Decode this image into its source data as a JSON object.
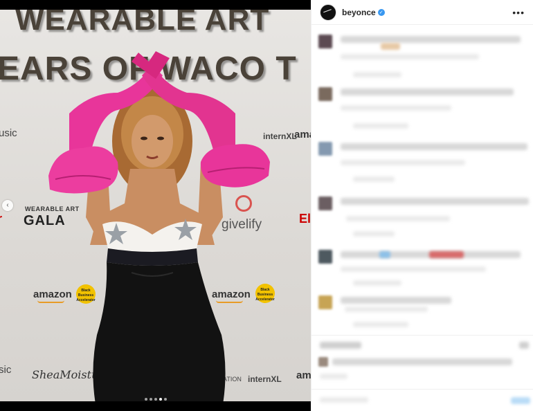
{
  "post": {
    "backdrop_line1": "WEARABLE ART",
    "backdrop_line2": "EARS OF WACO T",
    "logos": {
      "music_left_top": "usic",
      "music_left_bottom": "sic",
      "gala_top": "WEARABLE ART",
      "gala": "GALA",
      "givelify": "givelify",
      "amazon": "amazon",
      "badge": "Black Business Accelerator",
      "intern_right": "internXL",
      "intern_bottom": "internXL",
      "shea": "SheaMoisture",
      "ation": "ATION",
      "red_right": "El",
      "red_left": "r"
    },
    "carousel_dots": 5,
    "carousel_active": 4
  },
  "panel": {
    "username": "beyonce",
    "verified_glyph": "✓",
    "more_glyph": "•••"
  },
  "colors": {
    "glove_pink": "#e8359a",
    "dress_black": "#121212",
    "bodice_white": "#f4f2ee",
    "verified_blue": "#3897f0"
  }
}
